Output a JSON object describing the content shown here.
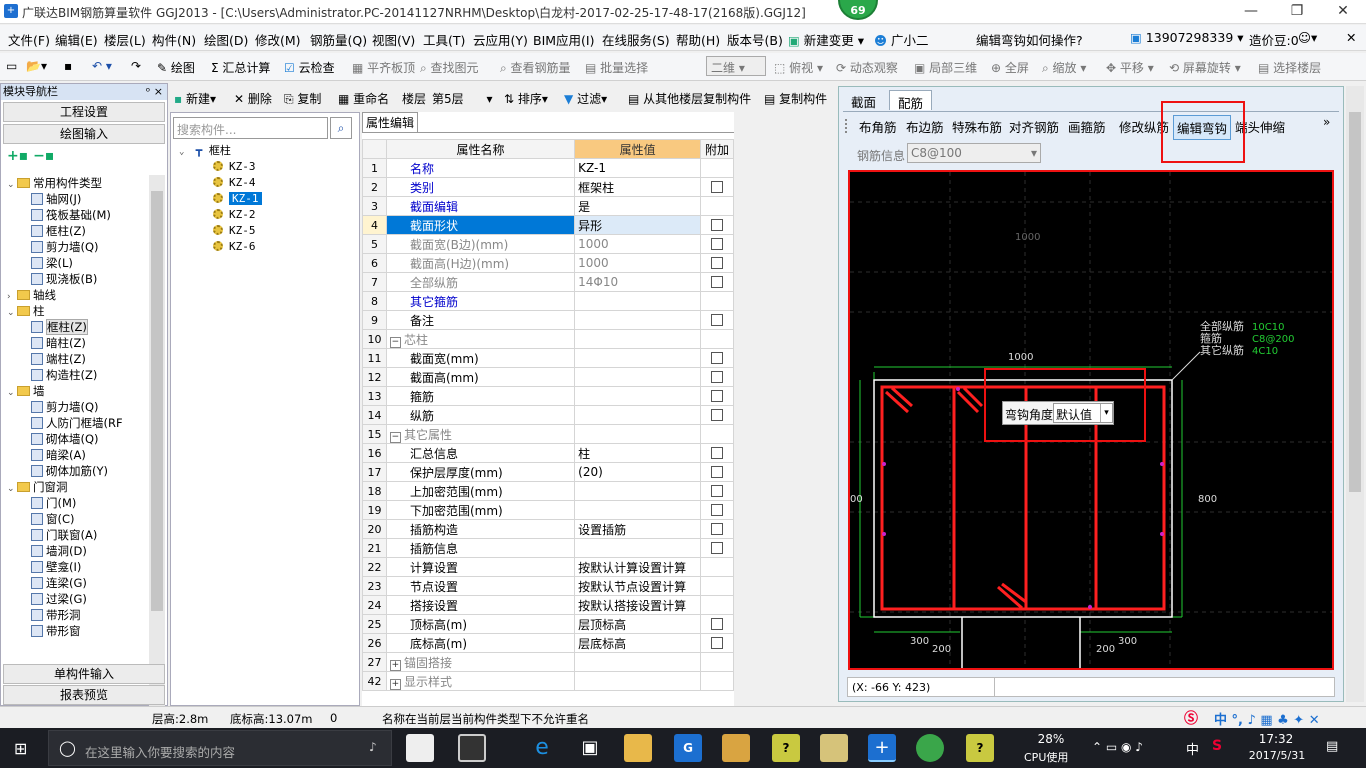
{
  "window": {
    "title": "广联达BIM钢筋算量软件 GGJ2013 - [C:\\Users\\Administrator.PC-20141127NRHM\\Desktop\\白龙村-2017-02-25-17-48-17(2168版).GGJ12]",
    "badge": "69"
  },
  "menu": [
    "文件(F)",
    "编辑(E)",
    "楼层(L)",
    "构件(N)",
    "绘图(D)",
    "修改(M)",
    "钢筋量(Q)",
    "视图(V)",
    "工具(T)",
    "云应用(Y)",
    "BIM应用(I)",
    "在线服务(S)",
    "帮助(H)",
    "版本号(B)",
    "新建变更",
    "广小二",
    "编辑弯钩如何操作?",
    "13907298339",
    "造价豆:0"
  ],
  "toolbar": [
    "绘图",
    "Σ 汇总计算",
    "云检查",
    "平齐板顶",
    "查找图元",
    "查看钢筋量",
    "批量选择",
    "二维",
    "俯视",
    "动态观察",
    "局部三维",
    "全屏",
    "缩放",
    "平移",
    "屏幕旋转",
    "选择楼层"
  ],
  "toolbar2": [
    "新建",
    "删除",
    "复制",
    "重命名",
    "楼层",
    "第5层",
    "排序",
    "过滤",
    "从其他楼层复制构件",
    "复制构件"
  ],
  "nav": {
    "header": "模块导航栏",
    "pin": "ᵒ ×",
    "btn_engineering": "工程设置",
    "btn_drawing": "绘图输入",
    "btn_single": "单构件输入",
    "btn_report": "报表预览",
    "tree": [
      {
        "t": "常用构件类型",
        "lvl": 0,
        "folder": true,
        "exp": "⌄"
      },
      {
        "t": "轴网(J)",
        "lvl": 1
      },
      {
        "t": "筏板基础(M)",
        "lvl": 1
      },
      {
        "t": "框柱(Z)",
        "lvl": 1
      },
      {
        "t": "剪力墙(Q)",
        "lvl": 1
      },
      {
        "t": "梁(L)",
        "lvl": 1
      },
      {
        "t": "现浇板(B)",
        "lvl": 1
      },
      {
        "t": "轴线",
        "lvl": 0,
        "folder": true,
        "exp": "›"
      },
      {
        "t": "柱",
        "lvl": 0,
        "folder": true,
        "exp": "⌄"
      },
      {
        "t": "框柱(Z)",
        "lvl": 1,
        "sel": true
      },
      {
        "t": "暗柱(Z)",
        "lvl": 1
      },
      {
        "t": "端柱(Z)",
        "lvl": 1
      },
      {
        "t": "构造柱(Z)",
        "lvl": 1
      },
      {
        "t": "墙",
        "lvl": 0,
        "folder": true,
        "exp": "⌄"
      },
      {
        "t": "剪力墙(Q)",
        "lvl": 1
      },
      {
        "t": "人防门框墙(RF",
        "lvl": 1
      },
      {
        "t": "砌体墙(Q)",
        "lvl": 1
      },
      {
        "t": "暗梁(A)",
        "lvl": 1
      },
      {
        "t": "砌体加筋(Y)",
        "lvl": 1
      },
      {
        "t": "门窗洞",
        "lvl": 0,
        "folder": true,
        "exp": "⌄"
      },
      {
        "t": "门(M)",
        "lvl": 1
      },
      {
        "t": "窗(C)",
        "lvl": 1
      },
      {
        "t": "门联窗(A)",
        "lvl": 1
      },
      {
        "t": "墙洞(D)",
        "lvl": 1
      },
      {
        "t": "壁龛(I)",
        "lvl": 1
      },
      {
        "t": "连梁(G)",
        "lvl": 1
      },
      {
        "t": "过梁(G)",
        "lvl": 1
      },
      {
        "t": "带形洞",
        "lvl": 1
      },
      {
        "t": "带形窗",
        "lvl": 1
      }
    ]
  },
  "components": {
    "search_placeholder": "搜索构件...",
    "root": "框柱",
    "items": [
      "KZ-3",
      "KZ-4",
      "KZ-1",
      "KZ-2",
      "KZ-5",
      "KZ-6"
    ],
    "selected": "KZ-1"
  },
  "props": {
    "tab": "属性编辑",
    "headers": [
      "属性名称",
      "属性值",
      "附加"
    ],
    "rows": [
      {
        "n": "1",
        "name": "名称",
        "val": "KZ-1",
        "cls": "blue",
        "chk": false
      },
      {
        "n": "2",
        "name": "类别",
        "val": "框架柱",
        "cls": "blue",
        "chk": true
      },
      {
        "n": "3",
        "name": "截面编辑",
        "val": "是",
        "cls": "blue",
        "chk": false
      },
      {
        "n": "4",
        "name": "截面形状",
        "val": "异形",
        "cls": "blue",
        "chk": true,
        "sel": true
      },
      {
        "n": "5",
        "name": "截面宽(B边)(mm)",
        "val": "1000",
        "cls": "grey",
        "chk": true
      },
      {
        "n": "6",
        "name": "截面高(H边)(mm)",
        "val": "1000",
        "cls": "grey",
        "chk": true
      },
      {
        "n": "7",
        "name": "全部纵筋",
        "val": "14Φ10",
        "cls": "grey",
        "chk": true
      },
      {
        "n": "8",
        "name": "其它箍筋",
        "val": "",
        "cls": "blue",
        "chk": false
      },
      {
        "n": "9",
        "name": "备注",
        "val": "",
        "cls": "",
        "chk": true
      },
      {
        "n": "10",
        "name": "芯柱",
        "val": "",
        "cls": "grey",
        "grp": "−",
        "chk": false
      },
      {
        "n": "11",
        "name": "截面宽(mm)",
        "val": "",
        "cls": "",
        "chk": true,
        "ind": true
      },
      {
        "n": "12",
        "name": "截面高(mm)",
        "val": "",
        "cls": "",
        "chk": true,
        "ind": true
      },
      {
        "n": "13",
        "name": "箍筋",
        "val": "",
        "cls": "",
        "chk": true,
        "ind": true
      },
      {
        "n": "14",
        "name": "纵筋",
        "val": "",
        "cls": "",
        "chk": true,
        "ind": true
      },
      {
        "n": "15",
        "name": "其它属性",
        "val": "",
        "cls": "grey",
        "grp": "−",
        "chk": false
      },
      {
        "n": "16",
        "name": "汇总信息",
        "val": "柱",
        "cls": "",
        "chk": true,
        "ind": true
      },
      {
        "n": "17",
        "name": "保护层厚度(mm)",
        "val": "(20)",
        "cls": "",
        "chk": true,
        "ind": true
      },
      {
        "n": "18",
        "name": "上加密范围(mm)",
        "val": "",
        "cls": "",
        "chk": true,
        "ind": true
      },
      {
        "n": "19",
        "name": "下加密范围(mm)",
        "val": "",
        "cls": "",
        "chk": true,
        "ind": true
      },
      {
        "n": "20",
        "name": "插筋构造",
        "val": "设置插筋",
        "cls": "",
        "chk": true,
        "ind": true
      },
      {
        "n": "21",
        "name": "插筋信息",
        "val": "",
        "cls": "",
        "chk": true,
        "ind": true
      },
      {
        "n": "22",
        "name": "计算设置",
        "val": "按默认计算设置计算",
        "cls": "",
        "chk": false,
        "ind": true
      },
      {
        "n": "23",
        "name": "节点设置",
        "val": "按默认节点设置计算",
        "cls": "",
        "chk": false,
        "ind": true
      },
      {
        "n": "24",
        "name": "搭接设置",
        "val": "按默认搭接设置计算",
        "cls": "",
        "chk": false,
        "ind": true
      },
      {
        "n": "25",
        "name": "顶标高(m)",
        "val": "层顶标高",
        "cls": "",
        "chk": true,
        "ind": true
      },
      {
        "n": "26",
        "name": "底标高(m)",
        "val": "层底标高",
        "cls": "",
        "chk": true,
        "ind": true
      },
      {
        "n": "27",
        "name": "锚固搭接",
        "val": "",
        "cls": "grey",
        "grp": "+",
        "chk": false
      },
      {
        "n": "42",
        "name": "显示样式",
        "val": "",
        "cls": "grey",
        "grp": "+",
        "chk": false
      }
    ]
  },
  "editor": {
    "tabs": [
      "截面",
      "配筋"
    ],
    "tools": [
      "布角筋",
      "布边筋",
      "特殊布筋",
      "对齐钢筋",
      "画箍筋",
      "修改纵筋",
      "编辑弯钩",
      "端头伸缩"
    ],
    "rebar_label": "钢筋信息",
    "rebar_value": "C8@100",
    "popup_label": "弯钩角度",
    "popup_value": "默认值",
    "dims": {
      "top": "1000",
      "top_grid": "1000",
      "right": "800",
      "left": "00",
      "b1": "300",
      "b2": "200",
      "b3": "200",
      "b4": "300"
    },
    "legend": {
      "l1": "全部纵筋",
      "l2": "箍筋",
      "l3": "其它纵筋",
      "v1": "10C10",
      "v2": "C8@200",
      "v3": "4C10"
    },
    "coords": "(X: -66 Y: 423)"
  },
  "status": {
    "floor_h": "层高:2.8m",
    "base_h": "底标高:13.07m",
    "zero": "0",
    "msg": "名称在当前层当前构件类型下不允许重名"
  },
  "taskbar": {
    "search": "在这里输入你要搜索的内容",
    "cpu_pct": "28%",
    "cpu_label": "CPU使用",
    "time": "17:32",
    "date": "2017/5/31",
    "ime": "中"
  },
  "colors": {
    "accent": "#0078d7",
    "highlight": "#e11111",
    "rebar": "#ff2020",
    "green_dim": "#22cc33"
  }
}
